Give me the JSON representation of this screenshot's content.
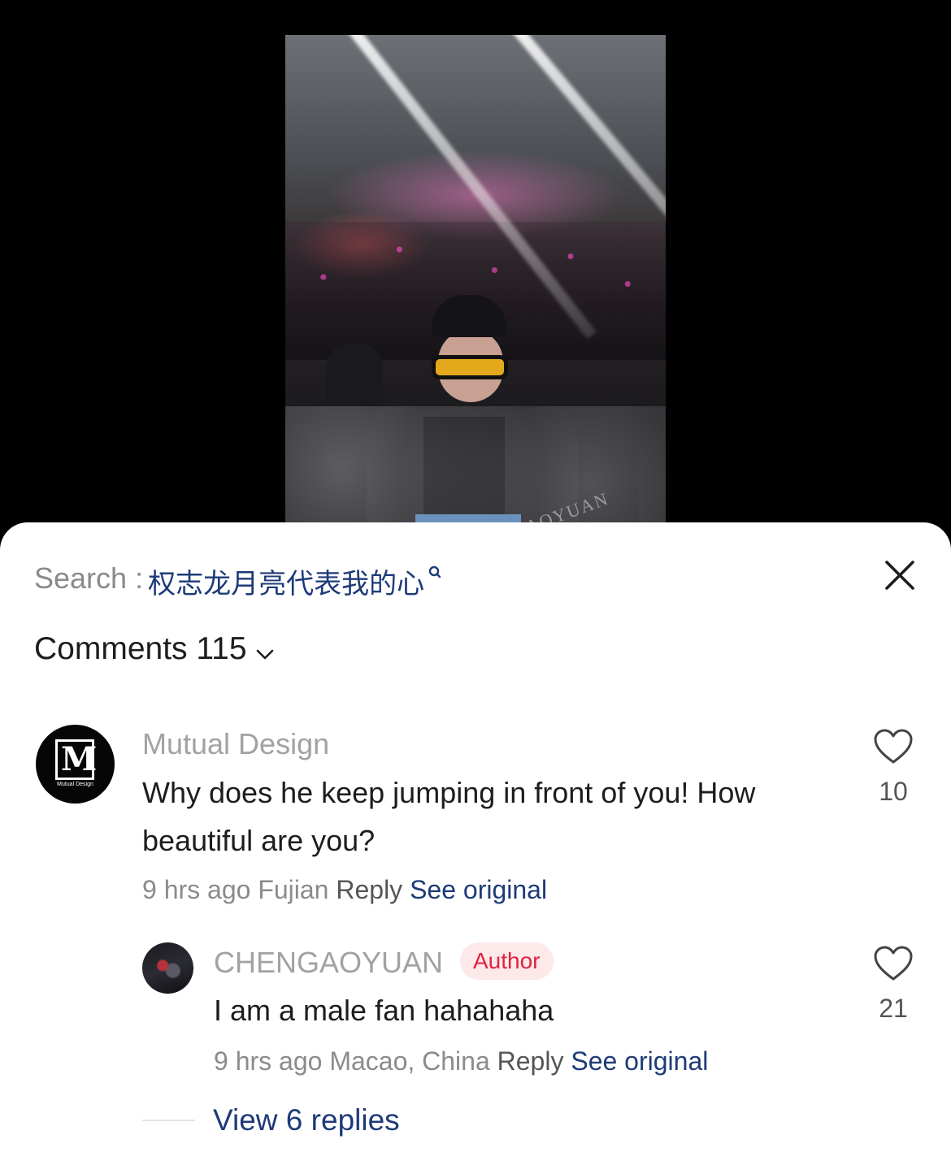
{
  "video": {
    "watermark": "CHENGAOYUAN"
  },
  "search": {
    "label": "Search : ",
    "query": "权志龙月亮代表我的心"
  },
  "comments_header": {
    "label": "Comments 115"
  },
  "comments": [
    {
      "username": "Mutual Design",
      "avatar_letter": "M",
      "avatar_sub": "Mutual Design",
      "text": "Why does he keep jumping in front of you! How beautiful are you?",
      "time": "9 hrs ago",
      "location": "Fujian",
      "reply_label": "Reply",
      "see_original": "See original",
      "likes": "10"
    },
    {
      "username": "CHENGAOYUAN",
      "badge": "Author",
      "text": "I am a male fan hahahaha",
      "time": "9 hrs ago",
      "location": "Macao, China",
      "reply_label": "Reply",
      "see_original": "See original",
      "likes": "21"
    }
  ],
  "view_replies": {
    "label": "View 6 replies"
  },
  "colors": {
    "link": "#1e3a78",
    "badge_text": "#e0233c",
    "badge_bg": "#fde8ea"
  },
  "icons": [
    "search-icon",
    "close-icon",
    "chevron-down-icon",
    "heart-icon"
  ]
}
